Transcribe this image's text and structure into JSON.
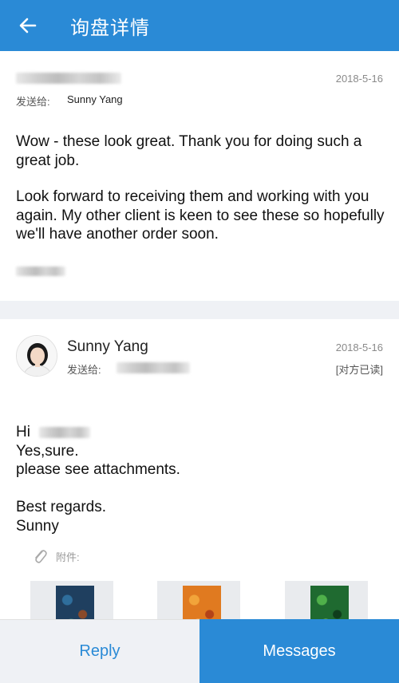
{
  "header": {
    "title": "询盘详情",
    "back_icon": "arrow-left-icon"
  },
  "message1": {
    "date": "2018-5-16",
    "send_to_label": "发送给:",
    "recipient": "Sunny Yang",
    "paragraphs": [
      "Wow - these look great.  Thank you for doing such a great job.",
      "Look forward to receiving them and working with you again.  My other client is keen to see these so hopefully we'll have another order soon."
    ]
  },
  "message2": {
    "sender": "Sunny Yang",
    "date": "2018-5-16",
    "send_to_label": "发送给:",
    "read_status": "[对方已读]",
    "greeting": "Hi",
    "lines": [
      "Yes,sure.",
      "please see attachments."
    ],
    "closing": [
      "Best regards.",
      "Sunny"
    ],
    "attachments_label": "附件:",
    "attachment_icon": "paperclip-icon"
  },
  "actions": {
    "reply": "Reply",
    "messages": "Messages"
  },
  "colors": {
    "primary": "#2a8ad6",
    "light_bg": "#eff1f5"
  }
}
